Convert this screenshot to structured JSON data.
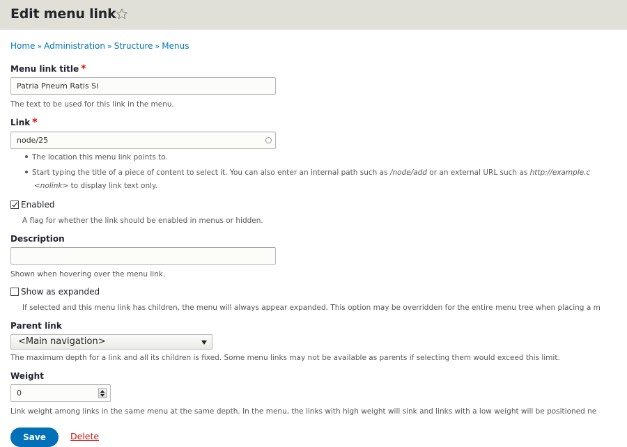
{
  "header": {
    "title": "Edit menu link",
    "shortcut_icon": "star-outline-icon",
    "background_color": "#e0dfd8"
  },
  "breadcrumb": {
    "items": [
      "Home",
      "Administration",
      "Structure",
      "Menus"
    ],
    "separator": "»"
  },
  "form": {
    "title_field": {
      "label": "Menu link title",
      "required_marker": "*",
      "value": "Patria Pneum Ratis Si",
      "description": "The text to be used for this link in the menu."
    },
    "link_field": {
      "label": "Link",
      "required_marker": "*",
      "value": "node/25",
      "autocomplete_icon": "autocomplete-throbber-icon",
      "help": {
        "item1": "The location this menu link points to.",
        "item2_part1": "Start typing the title of a piece of content to select it. You can also enter an internal path such as ",
        "item2_em1": "/node/add",
        "item2_part2": " or an external URL such as ",
        "item2_em2": "http://example.c",
        "item2_line2_em": "<nolink>",
        "item2_line2_rest": " to display link text only."
      }
    },
    "enabled": {
      "label": "Enabled",
      "checked": true,
      "description": "A flag for whether the link should be enabled in menus or hidden."
    },
    "description_field": {
      "label": "Description",
      "value": "",
      "description": "Shown when hovering over the menu link."
    },
    "expanded": {
      "label": "Show as expanded",
      "checked": false,
      "description": "If selected and this menu link has children, the menu will always appear expanded. This option may be overridden for the entire menu tree when placing a m"
    },
    "parent_link": {
      "label": "Parent link",
      "selected": "<Main navigation>",
      "description": "The maximum depth for a link and all its children is fixed. Some menu links may not be available as parents if selecting them would exceed this limit."
    },
    "weight": {
      "label": "Weight",
      "value": "0",
      "description": "Link weight among links in the same menu at the same depth. In the menu, the links with high weight will sink and links with a low weight will be positioned ne"
    }
  },
  "actions": {
    "save_label": "Save",
    "delete_label": "Delete",
    "save_color": "#0071b8",
    "delete_color": "#c5140c"
  }
}
